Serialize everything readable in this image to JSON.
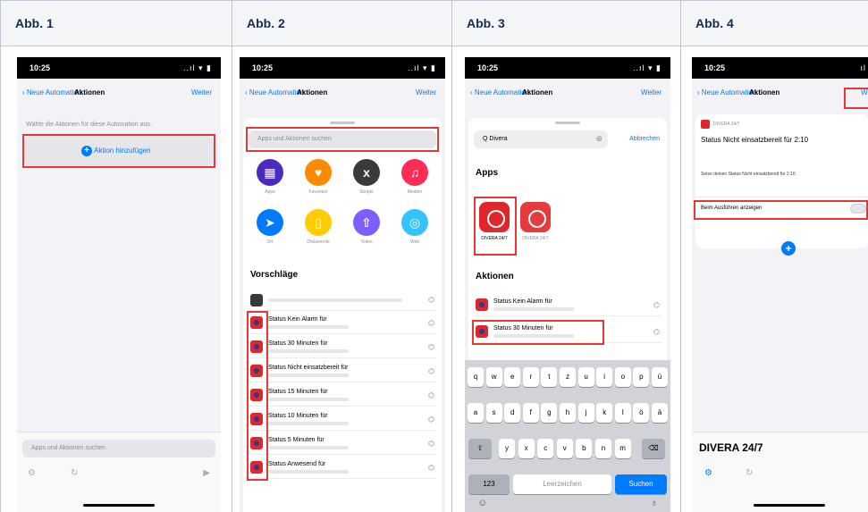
{
  "columns": [
    {
      "header": "Abb. 1"
    },
    {
      "header": "Abb. 2"
    },
    {
      "header": "Abb. 3"
    },
    {
      "header": "Abb. 4"
    }
  ],
  "phone": {
    "time": "10:25",
    "signal": "..ıl ▾ ▮",
    "back_label": "Neue Automation",
    "title": "Aktionen",
    "next_label": "Weiter"
  },
  "abb1": {
    "hint": "Wähle die Aktionen für diese Automation aus.",
    "add_action": "Aktion hinzufügen",
    "search_placeholder": "Apps und Aktionen suchen"
  },
  "abb2": {
    "search_placeholder": "Apps und Aktionen suchen",
    "categories": [
      {
        "label": "Apps",
        "color": "#4b2bbf",
        "glyph": "▦"
      },
      {
        "label": "Favoriten",
        "color": "#ff8a00",
        "glyph": "♥"
      },
      {
        "label": "Skripte",
        "color": "#3a3a3c",
        "glyph": "x"
      },
      {
        "label": "Medien",
        "color": "#ff2d55",
        "glyph": "♫"
      },
      {
        "label": "Ort",
        "color": "#007aff",
        "glyph": "➤"
      },
      {
        "label": "Dokumente",
        "color": "#ffcc00",
        "glyph": "▯"
      },
      {
        "label": "Teilen",
        "color": "#7d5fff",
        "glyph": "⇧"
      },
      {
        "label": "Web",
        "color": "#34c3ff",
        "glyph": "◎"
      }
    ],
    "suggestions_title": "Vorschläge",
    "rows": [
      "Status Kein Alarm für",
      "Status 30 Minuten für",
      "Status Nicht einsatzbereit für",
      "Status 15 Minuten für",
      "Status 10 Minuten für",
      "Status 5 Minuten für",
      "Status Anwesend für"
    ]
  },
  "abb3": {
    "search_value": "Q Divera",
    "cancel": "Abbrechen",
    "apps_title": "Apps",
    "app_labels": [
      "DIVERA 24/7",
      "DIVERA 24/7"
    ],
    "actions_title": "Aktionen",
    "actions": [
      "Status Kein Alarm für",
      "Status 30 Minuten für"
    ],
    "keyboard_row1": [
      "q",
      "w",
      "e",
      "r",
      "t",
      "z",
      "u",
      "i",
      "o",
      "p",
      "ü"
    ],
    "keyboard_row2": [
      "a",
      "s",
      "d",
      "f",
      "g",
      "h",
      "j",
      "k",
      "l",
      "ö",
      "ä"
    ],
    "keyboard_row3": [
      "y",
      "x",
      "c",
      "v",
      "b",
      "n",
      "m"
    ],
    "key_123": "123",
    "key_space": "Leerzeichen",
    "key_search": "Suchen"
  },
  "abb4": {
    "app_name": "DIVERA 24/7",
    "action_text": "Status Nicht einsatzbereit für 2:10",
    "detail_text": "Setze deinen Status Nicht einsatzbereit für 2:10",
    "toggle_label": "Beim Ausführen anzeigen",
    "footer_title": "DIVERA 24/7"
  }
}
